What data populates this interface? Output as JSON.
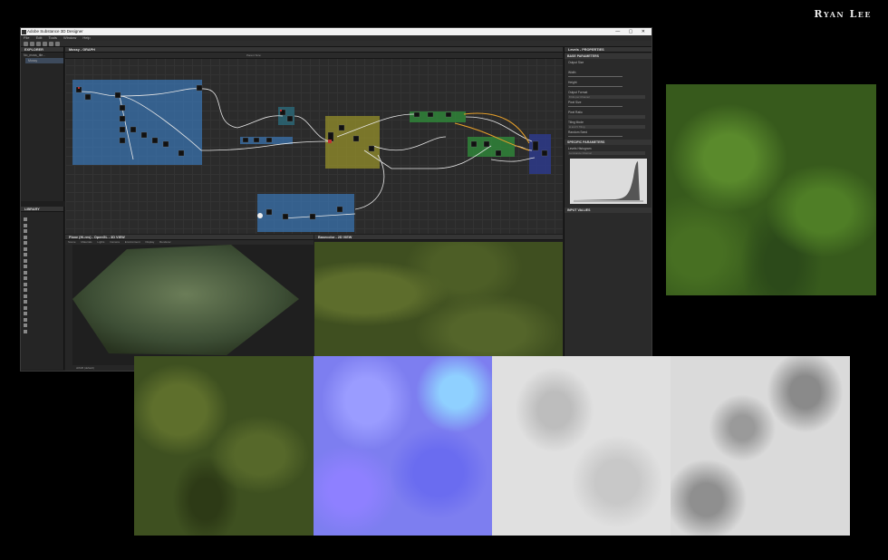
{
  "author": "Ryan Lee",
  "window": {
    "title": "Adobe Substance 3D Designer",
    "menu": [
      "File",
      "Edit",
      "Tools",
      "Window",
      "Help"
    ],
    "controls": "— ▢ ✕"
  },
  "explorer": {
    "title": "EXPLORER",
    "items": [
      "No_moss_tile...",
      "Mossy"
    ]
  },
  "library": {
    "title": "LIBRARY"
  },
  "graph": {
    "title": "Mossy - GRAPH",
    "parent_size_label": "Parent Size:"
  },
  "view3d": {
    "title": "Plane (Hi-res) - OpenGL - 3D VIEW",
    "tabs": [
      "Scene",
      "Materials",
      "Lights",
      "Camera",
      "Environment",
      "Display",
      "Renderer"
    ],
    "footer": "sRGB (default)"
  },
  "view2d": {
    "title": "Basecolor - 2D VIEW"
  },
  "properties": {
    "title": "Levels - PROPERTIES",
    "base_parameters": "BASE PARAMETERS",
    "output_size": "Output Size",
    "width_label": "Width",
    "height_label": "Height",
    "output_format": "Output Format",
    "output_format_value": "8 bits per Channel",
    "pixel_size": "Pixel Size",
    "pixel_ratio": "Pixel Ratio",
    "tiling_mode": "Tiling Mode",
    "tiling_mode_value": "H and V Tiling",
    "random_seed": "Random Seed",
    "specific_parameters": "SPECIFIC PARAMETERS",
    "levels_histogram": "Levels Histogram",
    "luminance_channel": "Luminance Channel",
    "input_values": "INPUT VALUES"
  },
  "colors": {
    "frame_blue": "#3a78b8",
    "frame_yellow": "#8f8a2a",
    "frame_green": "#2f8a3a",
    "frame_navy": "#2d3a8a",
    "frame_teal": "#2a6a7a",
    "normal_map": "#7d7ef0"
  }
}
